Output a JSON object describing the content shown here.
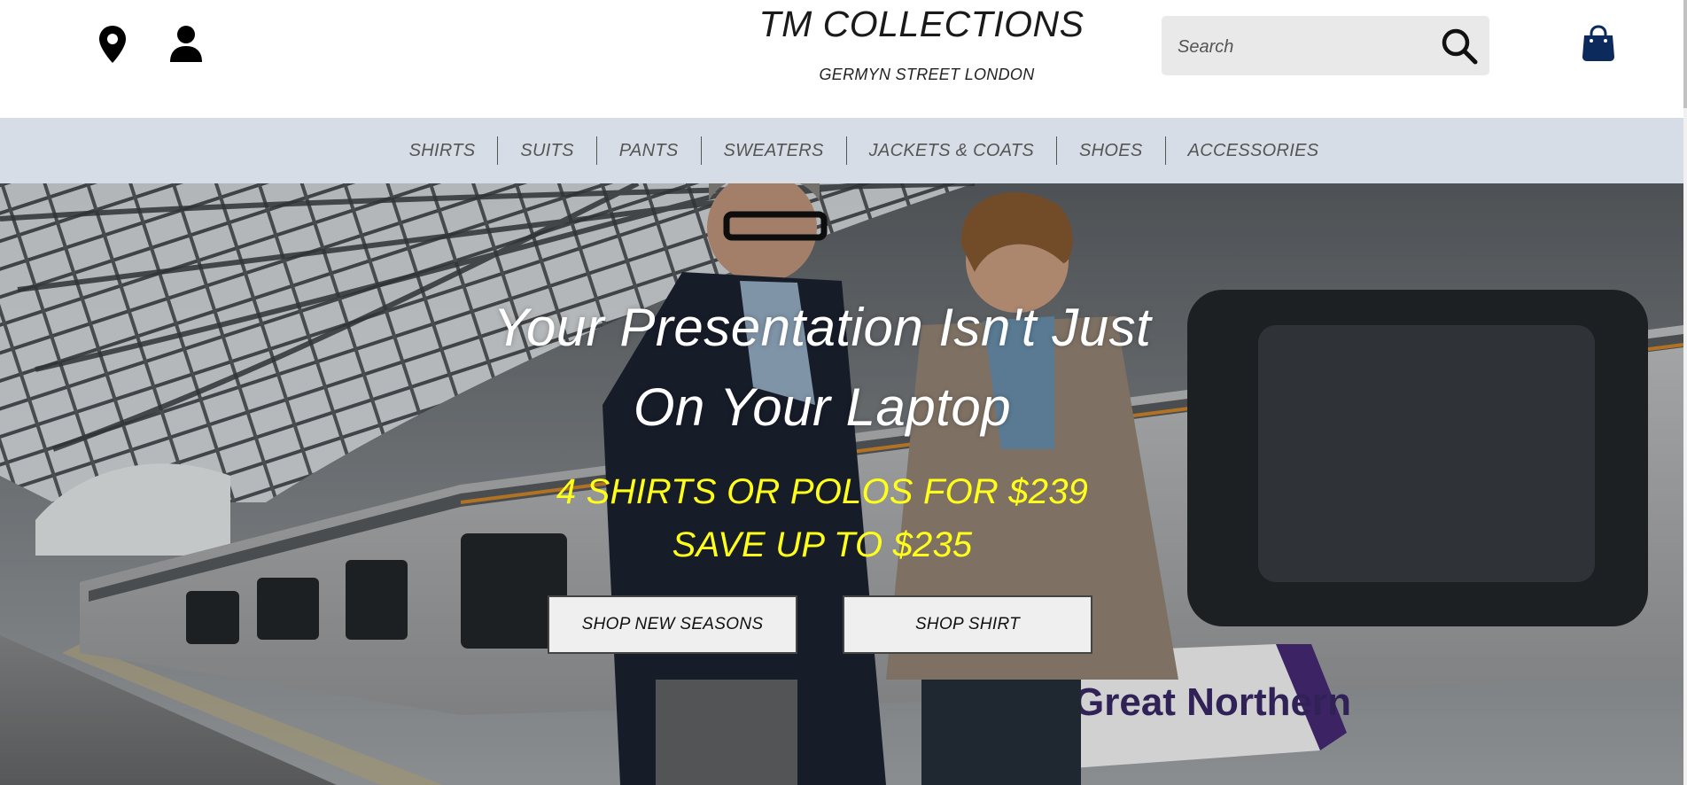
{
  "header": {
    "brand_title": "TM COLLECTIONS",
    "brand_subtitle": "GERMYN STREET LONDON",
    "search": {
      "placeholder": "Search"
    },
    "icons": [
      "location-pin-icon",
      "user-icon",
      "search-icon",
      "shopping-bag-icon"
    ]
  },
  "nav": {
    "items": [
      "SHIRTS",
      "SUITS",
      "PANTS",
      "SWEATERS",
      "JACKETS & COATS",
      "SHOES",
      "ACCESSORIES"
    ]
  },
  "hero": {
    "headline_line1": "Your Presentation Isn't Just",
    "headline_line2": "On Your Laptop",
    "promo_line1": "4 SHIRTS OR POLOS FOR $239",
    "promo_line2": "SAVE UP TO $235",
    "cta_primary": "SHOP NEW SEASONS",
    "cta_secondary": "SHOP SHIRT",
    "train_lettering": "Great Northern"
  },
  "colors": {
    "nav_background": "#d6dde6",
    "promo_text": "#ffff1a",
    "headline_text": "#ffffff",
    "bag_icon": "#0d2a5c",
    "search_background": "#e9e9e9"
  }
}
